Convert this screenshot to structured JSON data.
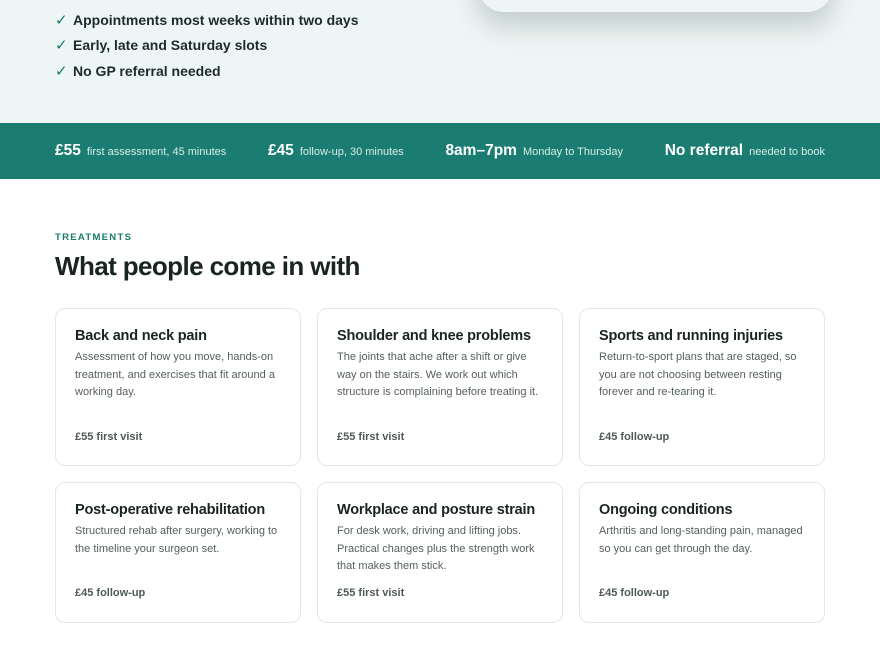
{
  "hero": {
    "benefits": [
      "Appointments most weeks within two days",
      "Early, late and Saturday slots",
      "No GP referral needed"
    ],
    "check_icon": "check-icon"
  },
  "stats": [
    {
      "value": "£55",
      "label": "first assessment, 45 minutes"
    },
    {
      "value": "£45",
      "label": "follow-up, 30 minutes"
    },
    {
      "value": "8am–7pm",
      "label": "Monday to Thursday"
    },
    {
      "value": "No referral",
      "label": "needed to book"
    }
  ],
  "treatments": {
    "eyebrow": "TREATMENTS",
    "title": "What people come in with",
    "cards": [
      {
        "title": "Back and neck pain",
        "description": "Assessment of how you move, hands-on treatment, and exercises that fit around a working day.",
        "price": "£55 first visit"
      },
      {
        "title": "Shoulder and knee problems",
        "description": "The joints that ache after a shift or give way on the stairs. We work out which structure is complaining before treating it.",
        "price": "£55 first visit"
      },
      {
        "title": "Sports and running injuries",
        "description": "Return-to-sport plans that are staged, so you are not choosing between resting forever and re-tearing it.",
        "price": "£45 follow-up"
      },
      {
        "title": "Post-operative rehabilitation",
        "description": "Structured rehab after surgery, working to the timeline your surgeon set.",
        "price": "£45 follow-up"
      },
      {
        "title": "Workplace and posture strain",
        "description": "For desk work, driving and lifting jobs. Practical changes plus the strength work that makes them stick.",
        "price": "£55 first visit"
      },
      {
        "title": "Ongoing conditions",
        "description": "Arthritis and long-standing pain, managed so you can get through the day.",
        "price": "£45 follow-up"
      }
    ]
  },
  "colors": {
    "accent": "#1b7d72",
    "hero_background": "#eef6f5",
    "eyebrow": "#187a69"
  }
}
